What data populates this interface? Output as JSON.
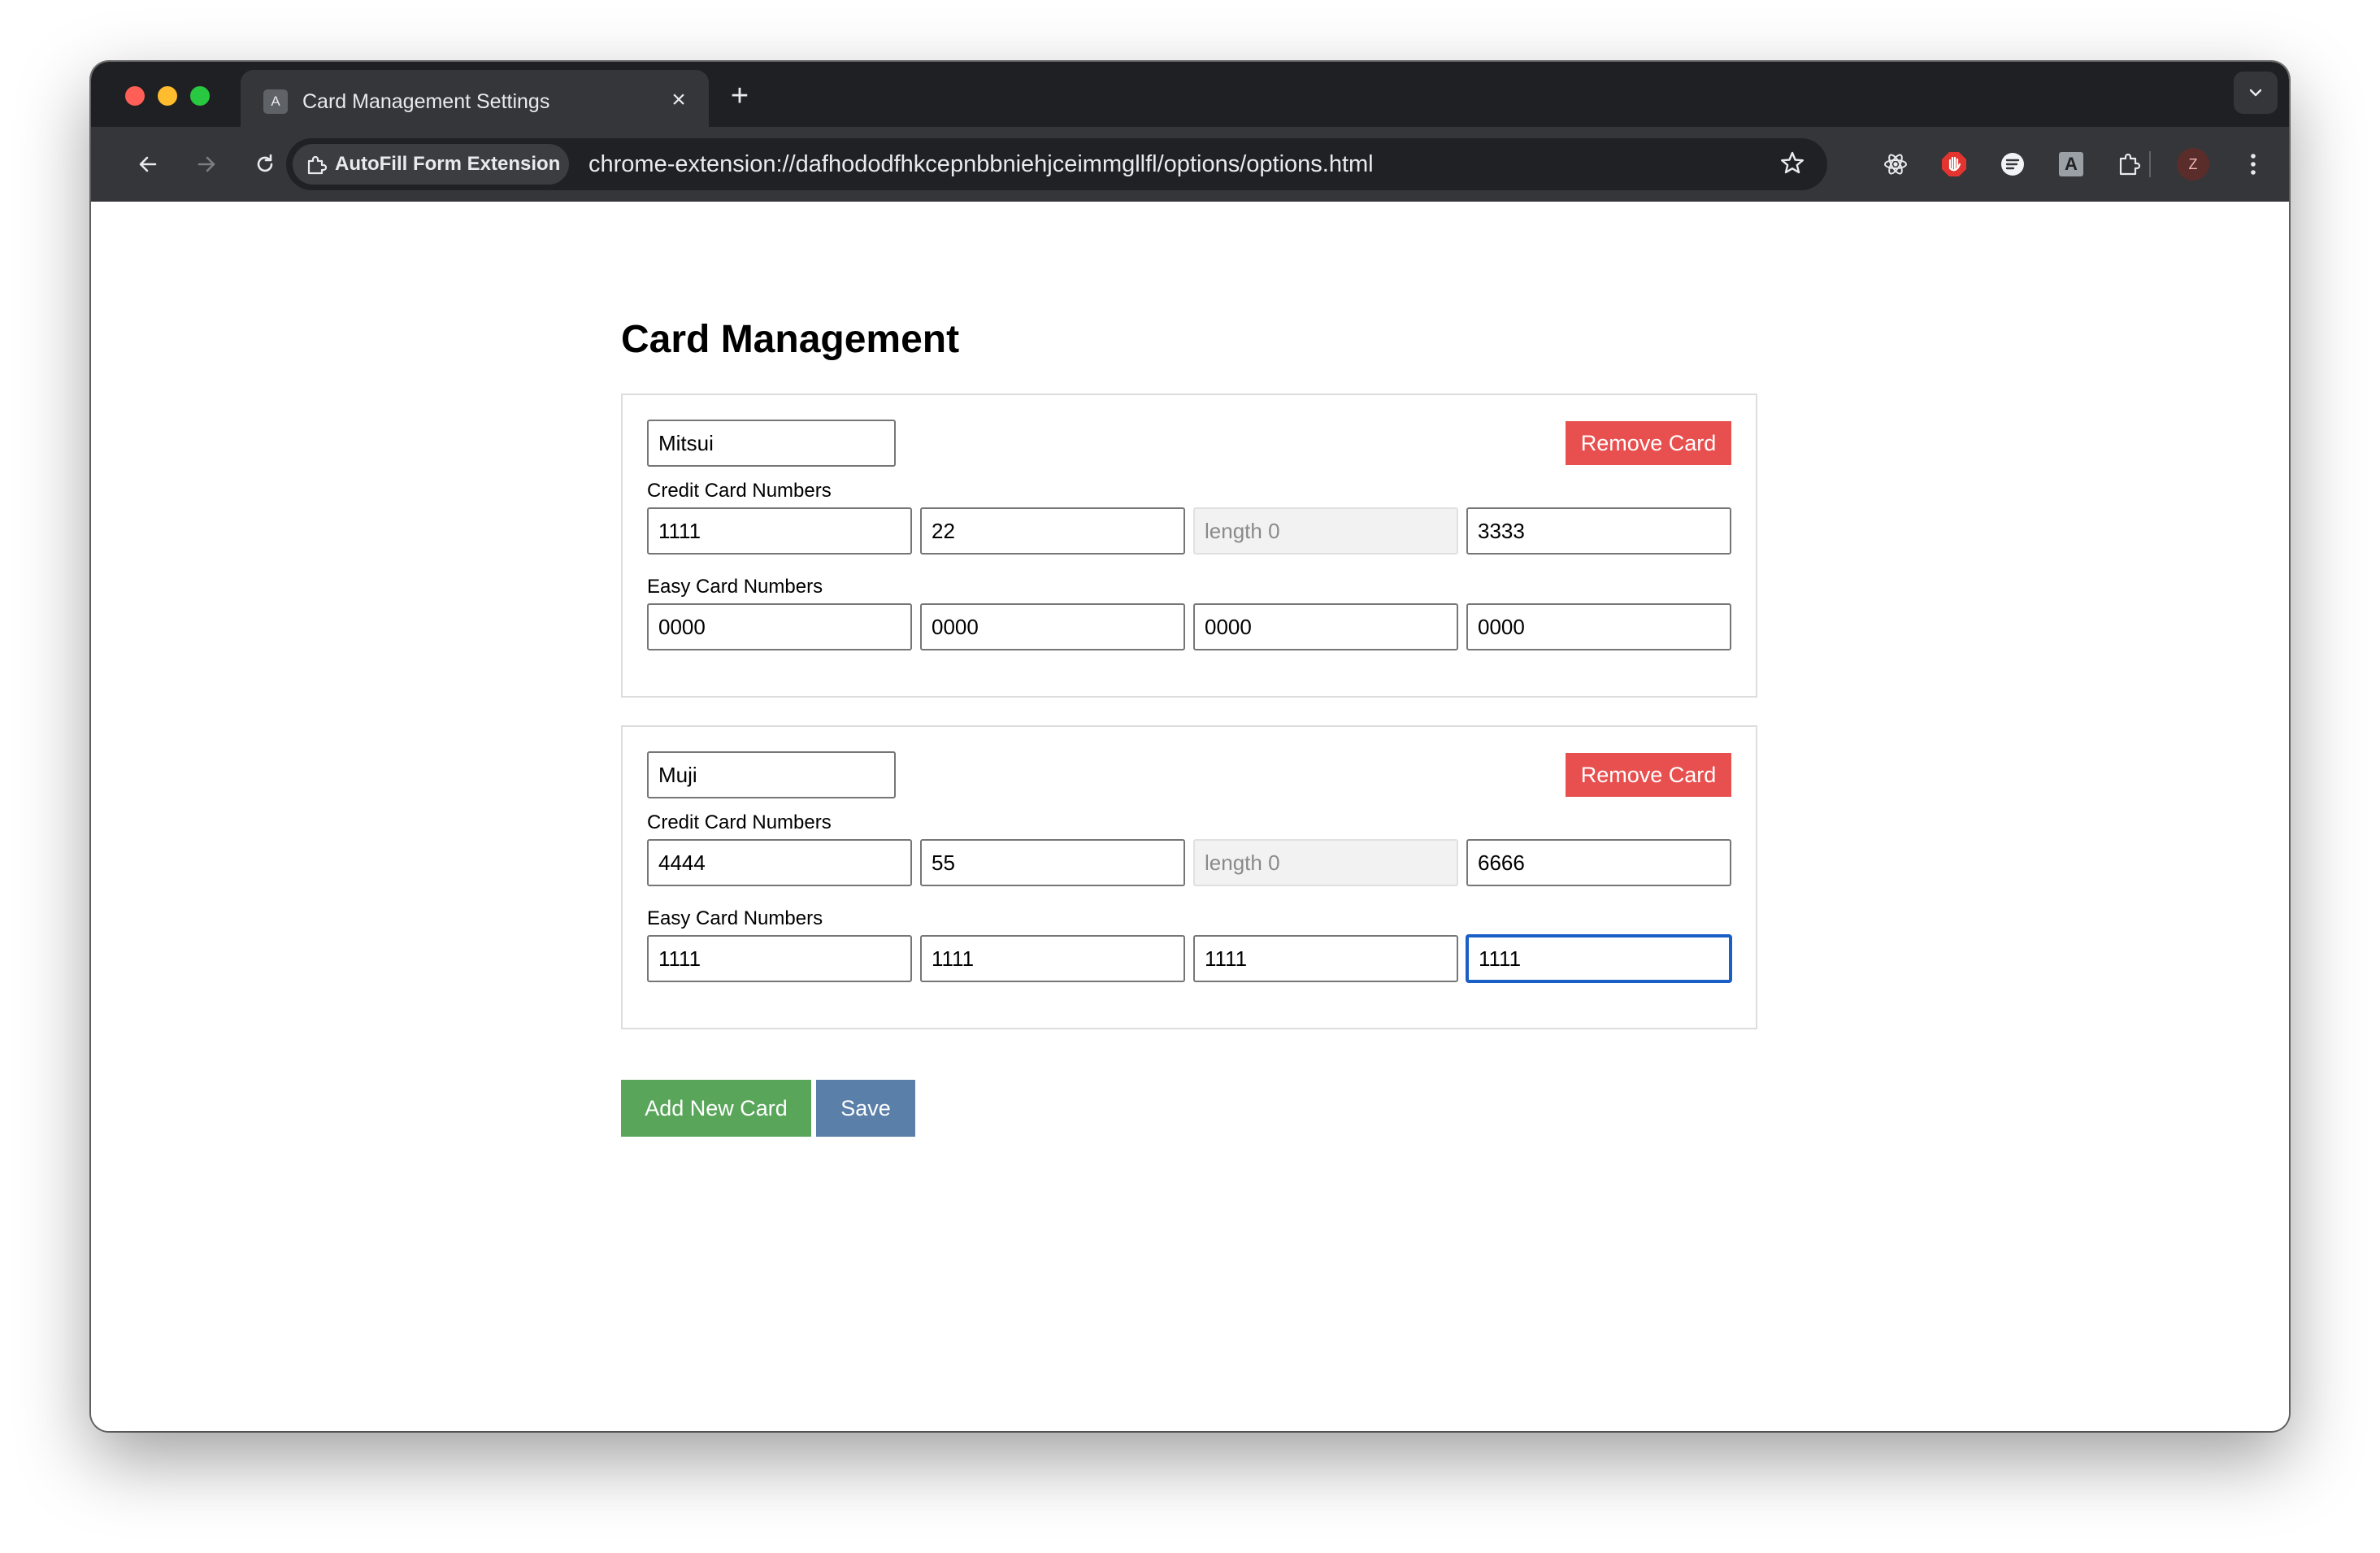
{
  "browser": {
    "tab": {
      "title": "Card Management Settings",
      "favicon_letter": "A"
    },
    "site_chip": "AutoFill Form Extension",
    "url": "chrome-extension://dafhododfhkcepnbbniehjceimmgllfl/options/options.html",
    "profile_initial": "Z",
    "extension_letter": "A",
    "icons": [
      "back-arrow-icon",
      "forward-arrow-icon",
      "reload-icon",
      "puzzle-piece-icon",
      "star-icon",
      "react-icon",
      "hand-stop-icon",
      "circle-extension-icon",
      "letter-a-extension-icon",
      "extensions-icon",
      "kebab-menu-icon",
      "chevron-down-icon"
    ]
  },
  "page": {
    "title": "Card Management",
    "credit_label": "Credit Card Numbers",
    "easy_label": "Easy Card Numbers",
    "remove_label": "Remove Card",
    "add_label": "Add New Card",
    "save_label": "Save"
  },
  "cards": [
    {
      "name": "Mitsui",
      "credit": [
        "1111",
        "22",
        "",
        "3333"
      ],
      "credit_placeholder": "length 0",
      "easy": [
        "0000",
        "0000",
        "0000",
        "0000"
      ]
    },
    {
      "name": "Muji",
      "credit": [
        "4444",
        "55",
        "",
        "6666"
      ],
      "credit_placeholder": "length 0",
      "easy": [
        "1111",
        "1111",
        "1111",
        "1111"
      ]
    }
  ],
  "colors": {
    "remove": "#e8504f",
    "add": "#59a55a",
    "save": "#5a7fa8",
    "focus": "#1a5fc6"
  }
}
